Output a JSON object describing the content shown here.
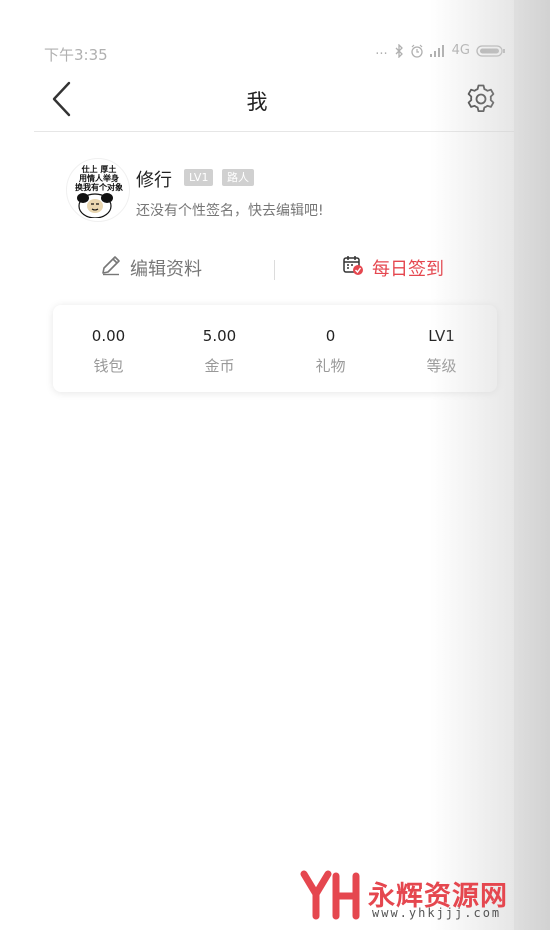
{
  "status_bar": {
    "time": "下午3:35",
    "signal_dots": "...",
    "network": "4G"
  },
  "nav": {
    "title": "我",
    "back_icon": "chevron-left-icon",
    "settings_icon": "gear-icon"
  },
  "profile": {
    "username": "修行",
    "level_tag": "LV1",
    "role_tag": "路人",
    "signature": "还没有个性签名，快去编辑吧!",
    "avatar_caption": [
      "仕上 厚土",
      "用情人举身",
      "换我有个对象"
    ]
  },
  "actions": {
    "edit_label": "编辑资料",
    "edit_icon": "pencil-icon",
    "checkin_label": "每日签到",
    "checkin_icon": "calendar-check-icon"
  },
  "stats": [
    {
      "value": "0.00",
      "label": "钱包"
    },
    {
      "value": "5.00",
      "label": "金币"
    },
    {
      "value": "0",
      "label": "礼物"
    },
    {
      "value": "LV1",
      "label": "等级"
    }
  ],
  "watermark": {
    "title": "永辉资源网",
    "url": "www.yhkjjj.com"
  },
  "colors": {
    "accent": "#e5474f",
    "tag_bg": "#d0d0d0"
  }
}
